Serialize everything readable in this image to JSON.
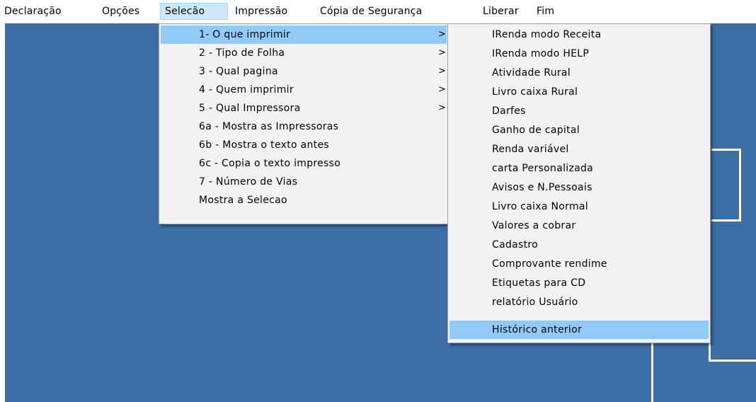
{
  "menubar": {
    "items": [
      {
        "label": "Declaração"
      },
      {
        "label": "Opções"
      },
      {
        "label": "Selecão"
      },
      {
        "label": "Impressão"
      },
      {
        "label": "Cópia de Segurança"
      },
      {
        "label": "Liberar"
      },
      {
        "label": "Fim"
      }
    ]
  },
  "selecao_menu": {
    "submenu_arrow": ">",
    "items": [
      {
        "label": "1- O que imprimir"
      },
      {
        "label": "2 - Tipo de Folha"
      },
      {
        "label": "3 - Qual pagina"
      },
      {
        "label": "4 - Quem imprimir"
      },
      {
        "label": "5 - Qual Impressora"
      },
      {
        "label": "6a - Mostra as Impressoras"
      },
      {
        "label": "6b - Mostra o texto antes"
      },
      {
        "label": "6c - Copia o texto impresso"
      },
      {
        "label": "7  - Número de Vias"
      },
      {
        "label": "Mostra a Selecao"
      }
    ]
  },
  "o_que_imprimir_submenu": {
    "items": [
      {
        "label": "IRenda modo Receita"
      },
      {
        "label": "IRenda modo  HELP"
      },
      {
        "label": "Atividade Rural"
      },
      {
        "label": "Livro caixa Rural"
      },
      {
        "label": "Darfes"
      },
      {
        "label": "Ganho de capital"
      },
      {
        "label": "Renda variável"
      },
      {
        "label": "carta Personalizada"
      },
      {
        "label": "Avisos e N.Pessoais"
      },
      {
        "label": "Livro caixa Normal"
      },
      {
        "label": "Valores a cobrar"
      },
      {
        "label": "Cadastro"
      },
      {
        "label": "Comprovante rendime"
      },
      {
        "label": "Etiquetas para CD"
      },
      {
        "label": "relatório Usuário"
      },
      {
        "label": "Histórico anterior"
      }
    ]
  },
  "colors": {
    "workspace": "#3a6ea5",
    "menu_bg": "#f2f2f2",
    "highlight": "#91c9f7",
    "menubar_active": "#cce8ff"
  }
}
